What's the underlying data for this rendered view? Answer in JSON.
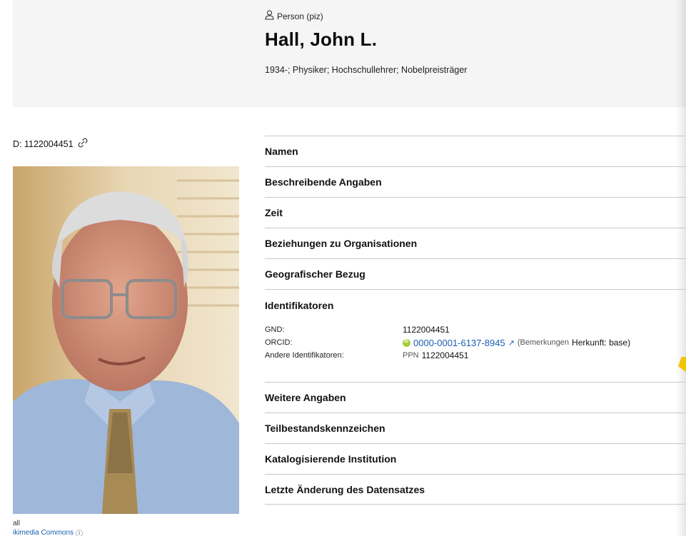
{
  "header": {
    "type_label": "Person (piz)",
    "title": "Hall, John L.",
    "subtitle": "1934-; Physiker; Hochschullehrer; Nobelpreisträger"
  },
  "sidebar": {
    "id_text": "D: 1122004451",
    "caption_name": "all",
    "caption_source": "ikimedia Commons"
  },
  "sections": {
    "names": "Namen",
    "descriptive": "Beschreibende Angaben",
    "time": "Zeit",
    "org_relations": "Beziehungen zu Organisationen",
    "geo": "Geografischer Bezug",
    "identifiers": "Identifikatoren",
    "more": "Weitere Angaben",
    "partial": "Teilbestandskennzeichen",
    "cataloging": "Katalogisierende Institution",
    "last_change": "Letzte Änderung des Datensatzes"
  },
  "identifiers": {
    "gnd_label": "GND:",
    "gnd_value": "1122004451",
    "orcid_label": "ORCID:",
    "orcid_value": "0000-0001-6137-8945",
    "orcid_note_prefix": "(Bemerkungen",
    "orcid_note": "Herkunft: base)",
    "other_label": "Andere Identifikatoren:",
    "other_prefix": "PPN",
    "other_value": "1122004451"
  },
  "colors": {
    "link": "#1a5fb4",
    "orcid_green": "#a6ce39",
    "header_bg": "#f5f5f5"
  },
  "icons": [
    "person-icon",
    "link-icon",
    "orcid-icon",
    "external-link-icon",
    "info-icon"
  ]
}
